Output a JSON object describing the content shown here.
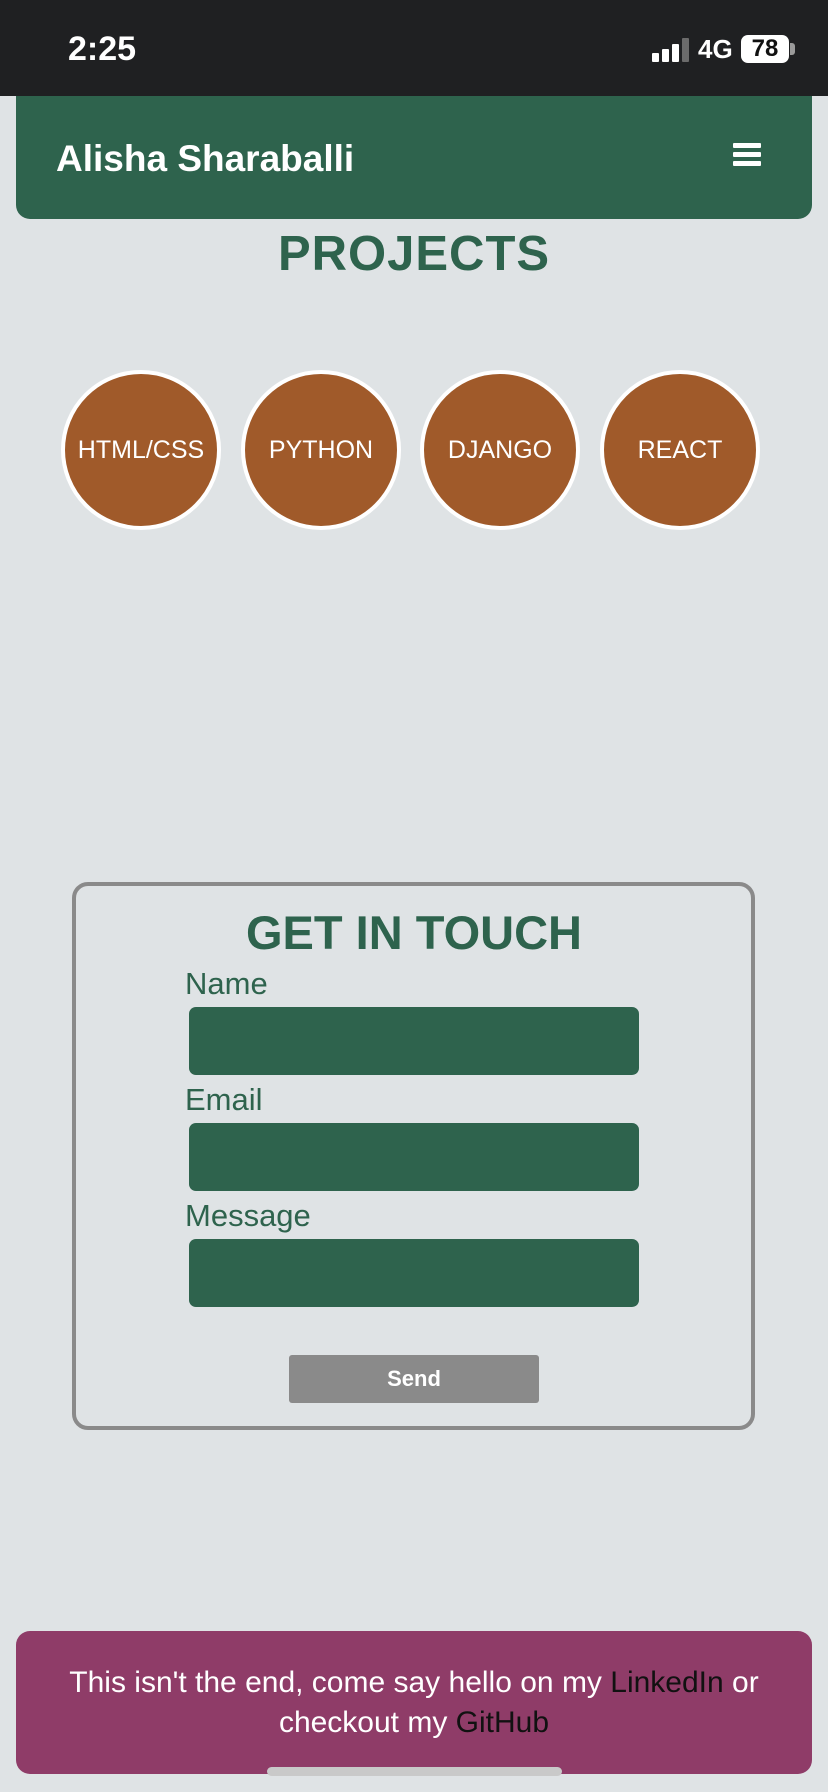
{
  "status_bar": {
    "time": "2:25",
    "network": "4G",
    "battery": "78"
  },
  "navbar": {
    "brand": "Alisha Sharaballi",
    "menu_icon": "hamburger-menu-icon"
  },
  "projects": {
    "title": "PROJECTS",
    "items": [
      "HTML/CSS",
      "PYTHON",
      "DJANGO",
      "REACT"
    ]
  },
  "contact": {
    "title": "GET IN TOUCH",
    "name_label": "Name",
    "email_label": "Email",
    "message_label": "Message",
    "name_value": "",
    "email_value": "",
    "message_value": "",
    "send_label": "Send"
  },
  "footer": {
    "text_before": "This isn't the end, come say hello on my ",
    "linkedin": "LinkedIn",
    "text_middle": " or checkout my ",
    "github": "GitHub"
  },
  "colors": {
    "background": "#dfe3e5",
    "primary_green": "#2e634d",
    "circle_brown": "#a05a2a",
    "footer_plum": "#8f3c68",
    "button_gray": "#8a8a8a"
  }
}
